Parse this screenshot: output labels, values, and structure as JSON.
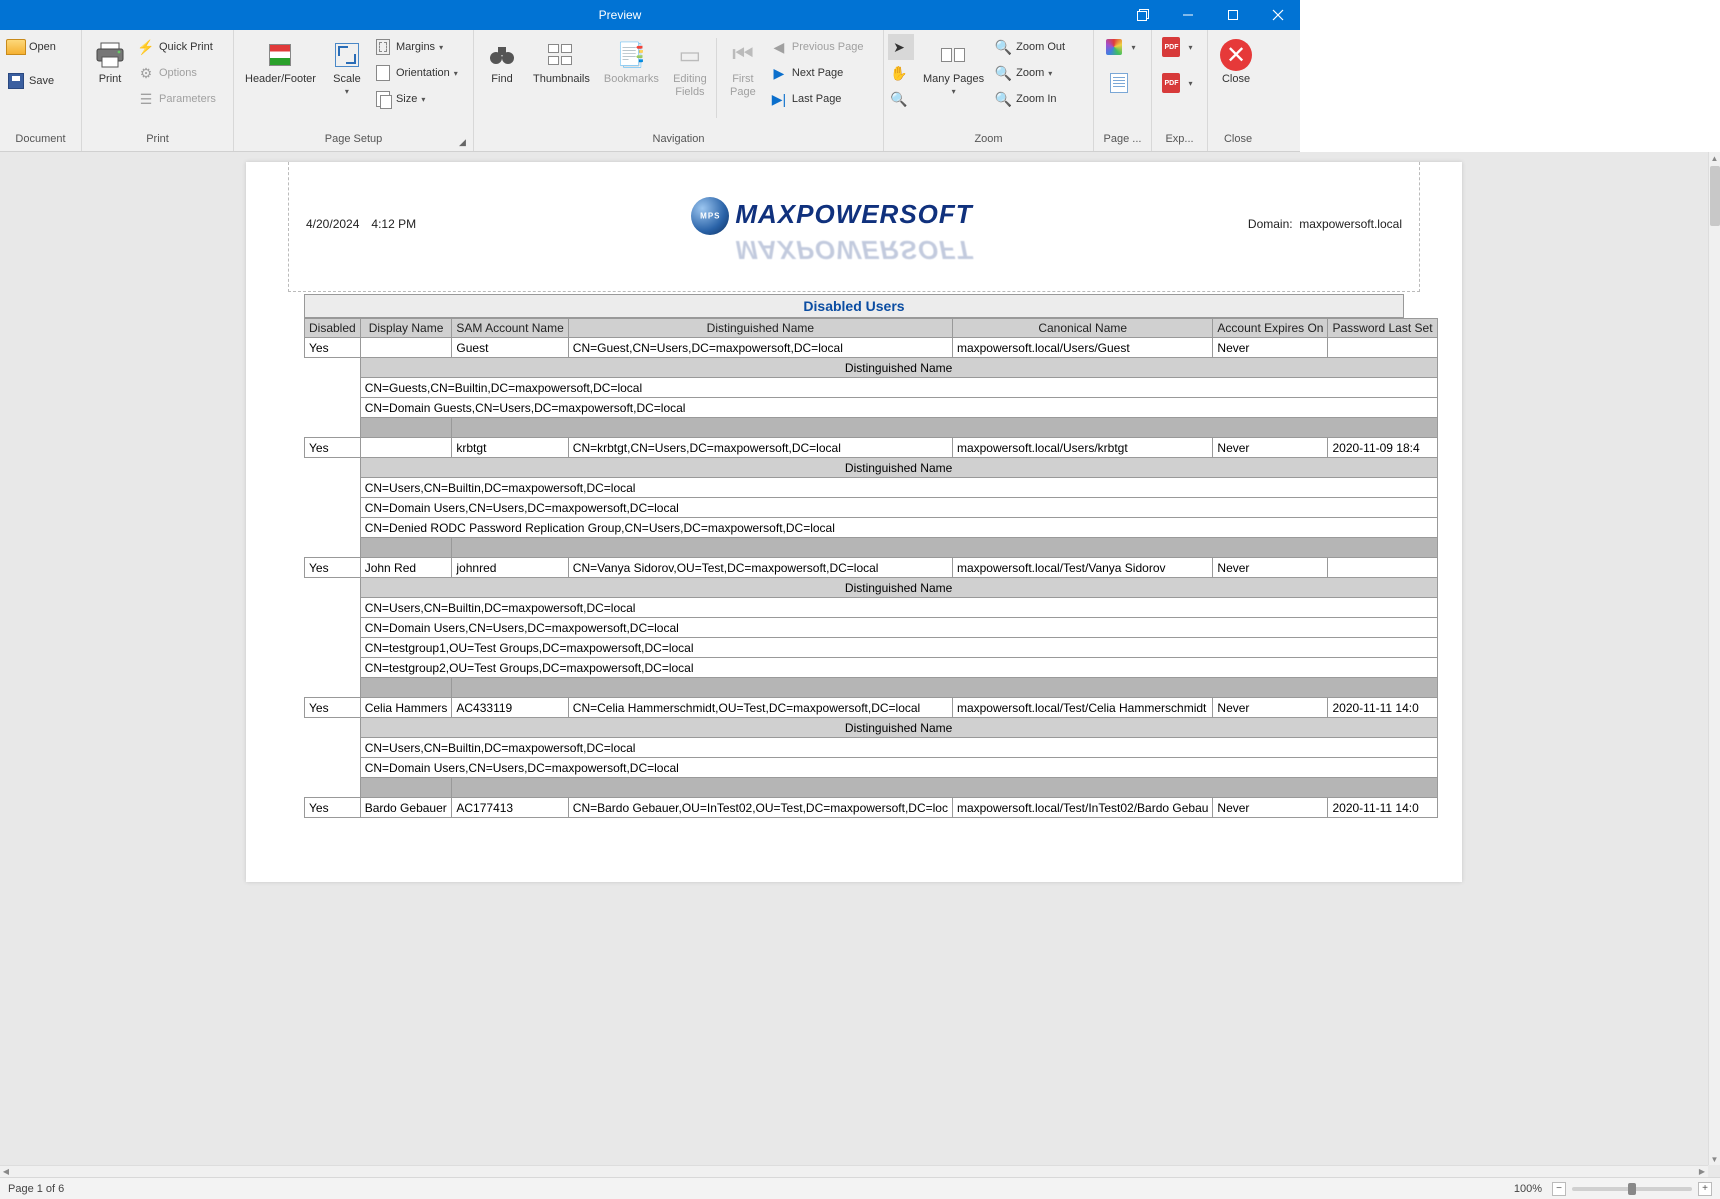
{
  "window": {
    "title": "Preview"
  },
  "ribbon": {
    "groups": {
      "document": {
        "label": "Document",
        "open": "Open",
        "save": "Save"
      },
      "print": {
        "label": "Print",
        "print": "Print",
        "quick": "Quick Print",
        "options": "Options",
        "parameters": "Parameters"
      },
      "page_setup": {
        "label": "Page Setup",
        "header_footer": "Header/Footer",
        "scale": "Scale",
        "margins": "Margins",
        "orientation": "Orientation",
        "size": "Size"
      },
      "navigation": {
        "label": "Navigation",
        "find": "Find",
        "thumbnails": "Thumbnails",
        "bookmarks": "Bookmarks",
        "editing_fields_l1": "Editing",
        "editing_fields_l2": "Fields",
        "first_l1": "First",
        "first_l2": "Page",
        "prev": "Previous  Page",
        "next": "Next   Page",
        "last": "Last   Page"
      },
      "zoom": {
        "label": "Zoom",
        "pointer": "",
        "hand": "",
        "magnifier": "",
        "many_pages": "Many Pages",
        "zoom_out": "Zoom Out",
        "zoom": "Zoom",
        "zoom_in": "Zoom In"
      },
      "page_color": {
        "label": "Page ..."
      },
      "export": {
        "label": "Exp..."
      },
      "close": {
        "label": "Close",
        "btn": "Close"
      }
    }
  },
  "report": {
    "timestamp_date": "4/20/2024",
    "timestamp_time": "4:12 PM",
    "brand": "MAXPOWERSOFT",
    "domain_label": "Domain:",
    "domain_value": "maxpowersoft.local",
    "title": "Disabled Users",
    "columns": {
      "disabled": "Disabled",
      "display_name": "Display Name",
      "sam": "SAM Account Name",
      "dn": "Distinguished Name",
      "canonical": "Canonical Name",
      "expires": "Account Expires On",
      "pwd": "Password Last Set"
    },
    "sub_header": "Distinguished Name",
    "rows": [
      {
        "disabled": "Yes",
        "display_name": "",
        "sam": "Guest",
        "dn": "CN=Guest,CN=Users,DC=maxpowersoft,DC=local",
        "canonical": "maxpowersoft.local/Users/Guest",
        "expires": "Never",
        "pwd": "",
        "members": [
          "CN=Guests,CN=Builtin,DC=maxpowersoft,DC=local",
          "CN=Domain Guests,CN=Users,DC=maxpowersoft,DC=local"
        ]
      },
      {
        "disabled": "Yes",
        "display_name": "",
        "sam": "krbtgt",
        "dn": "CN=krbtgt,CN=Users,DC=maxpowersoft,DC=local",
        "canonical": "maxpowersoft.local/Users/krbtgt",
        "expires": "Never",
        "pwd": "2020-11-09 18:4",
        "members": [
          "CN=Users,CN=Builtin,DC=maxpowersoft,DC=local",
          "CN=Domain Users,CN=Users,DC=maxpowersoft,DC=local",
          "CN=Denied RODC Password Replication Group,CN=Users,DC=maxpowersoft,DC=local"
        ]
      },
      {
        "disabled": "Yes",
        "display_name": "John Red",
        "sam": "johnred",
        "dn": "CN=Vanya Sidorov,OU=Test,DC=maxpowersoft,DC=local",
        "canonical": "maxpowersoft.local/Test/Vanya Sidorov",
        "expires": "Never",
        "pwd": "",
        "members": [
          "CN=Users,CN=Builtin,DC=maxpowersoft,DC=local",
          "CN=Domain Users,CN=Users,DC=maxpowersoft,DC=local",
          "CN=testgroup1,OU=Test Groups,DC=maxpowersoft,DC=local",
          "CN=testgroup2,OU=Test Groups,DC=maxpowersoft,DC=local"
        ]
      },
      {
        "disabled": "Yes",
        "display_name": "Celia Hammers",
        "sam": "AC433119",
        "dn": "CN=Celia Hammerschmidt,OU=Test,DC=maxpowersoft,DC=local",
        "canonical": "maxpowersoft.local/Test/Celia Hammerschmidt",
        "expires": "Never",
        "pwd": "2020-11-11 14:0",
        "members": [
          "CN=Users,CN=Builtin,DC=maxpowersoft,DC=local",
          "CN=Domain Users,CN=Users,DC=maxpowersoft,DC=local"
        ]
      },
      {
        "disabled": "Yes",
        "display_name": "Bardo Gebauer",
        "sam": "AC177413",
        "dn": "CN=Bardo Gebauer,OU=InTest02,OU=Test,DC=maxpowersoft,DC=loc",
        "canonical": "maxpowersoft.local/Test/InTest02/Bardo Gebau",
        "expires": "Never",
        "pwd": "2020-11-11 14:0",
        "members": []
      }
    ]
  },
  "status": {
    "page": "Page 1 of 6",
    "zoom": "100%"
  }
}
